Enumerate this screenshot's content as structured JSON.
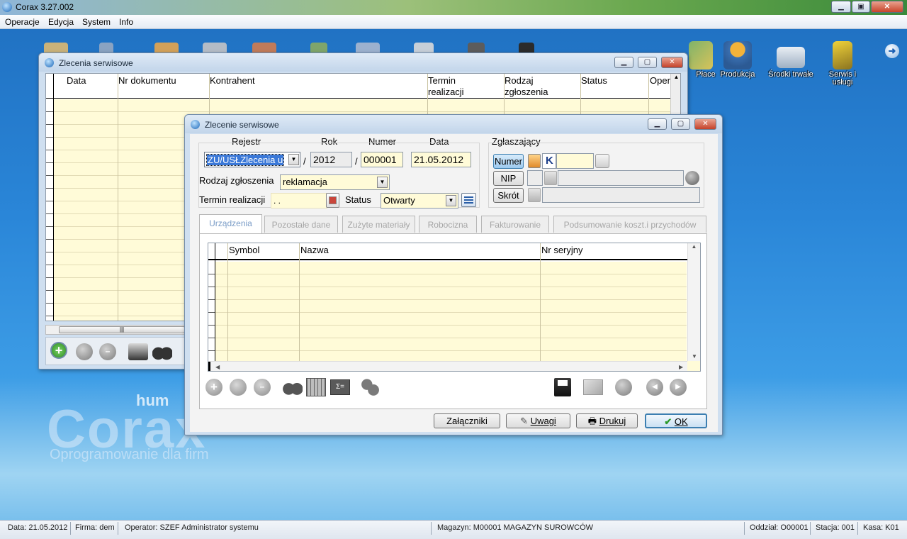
{
  "app": {
    "title": "Corax 3.27.002"
  },
  "menu": [
    "Operacje",
    "Edycja",
    "System",
    "Info"
  ],
  "desktop_icons": [
    {
      "label": "Płace",
      "icon": "money-icon"
    },
    {
      "label": "Produkcja",
      "icon": "worker-icon"
    },
    {
      "label": "Środki trwałe",
      "icon": "truck-icon"
    },
    {
      "label": "Serwis i usługi",
      "icon": "drill-icon"
    }
  ],
  "watermark": {
    "brand": "Corax",
    "vendor": "hum",
    "tagline": "Oprogramowanie dla firm"
  },
  "list_window": {
    "title": "Zlecenia serwisowe",
    "columns": [
      "Data",
      "Nr dokumentu",
      "Kontrahent",
      "Termin realizacji",
      "Rodzaj zgłoszenia",
      "Status",
      "Oper"
    ]
  },
  "dialog": {
    "title": "Zlecenie serwisowe",
    "labels": {
      "rejestr": "Rejestr",
      "rok": "Rok",
      "numer": "Numer",
      "data": "Data",
      "zglaszajacy": "Zgłaszający",
      "rodzaj": "Rodzaj zgłoszenia",
      "termin": "Termin realizacji",
      "status": "Status"
    },
    "values": {
      "rejestr": "ZU/USŁZlecenia u",
      "rok": "2012",
      "numer": "000001",
      "data": "21.05.2012",
      "rodzaj": "reklamacja",
      "termin": "  .  .",
      "status": "Otwarty",
      "k_letter": "K"
    },
    "sender_buttons": [
      "Numer",
      "NIP",
      "Skrót"
    ],
    "tabs": [
      "Urządzenia",
      "Pozostałe dane",
      "Zużyte materiały",
      "Robocizna",
      "Fakturowanie",
      "Podsumowanie koszt.i przychodów"
    ],
    "active_tab": "Urządzenia",
    "grid_columns": [
      "Symbol",
      "Nazwa",
      "Nr seryjny"
    ],
    "footer_buttons": [
      "Załączniki",
      "Uwagi",
      "Drukuj",
      "OK"
    ]
  },
  "statusbar": {
    "data": "Data: 21.05.2012",
    "firma": "Firma: dem",
    "operator": "Operator: SZEF Administrator systemu",
    "magazyn": "Magazyn: M00001 MAGAZYN SUROWCÓW",
    "oddzial": "Oddział: O00001",
    "stacja": "Stacja: 001",
    "kasa": "Kasa: K01"
  },
  "colors": {
    "grid_yellow": "#fffbd8",
    "window_chrome": "#cfdff0",
    "accent_blue": "#1a66b8"
  }
}
